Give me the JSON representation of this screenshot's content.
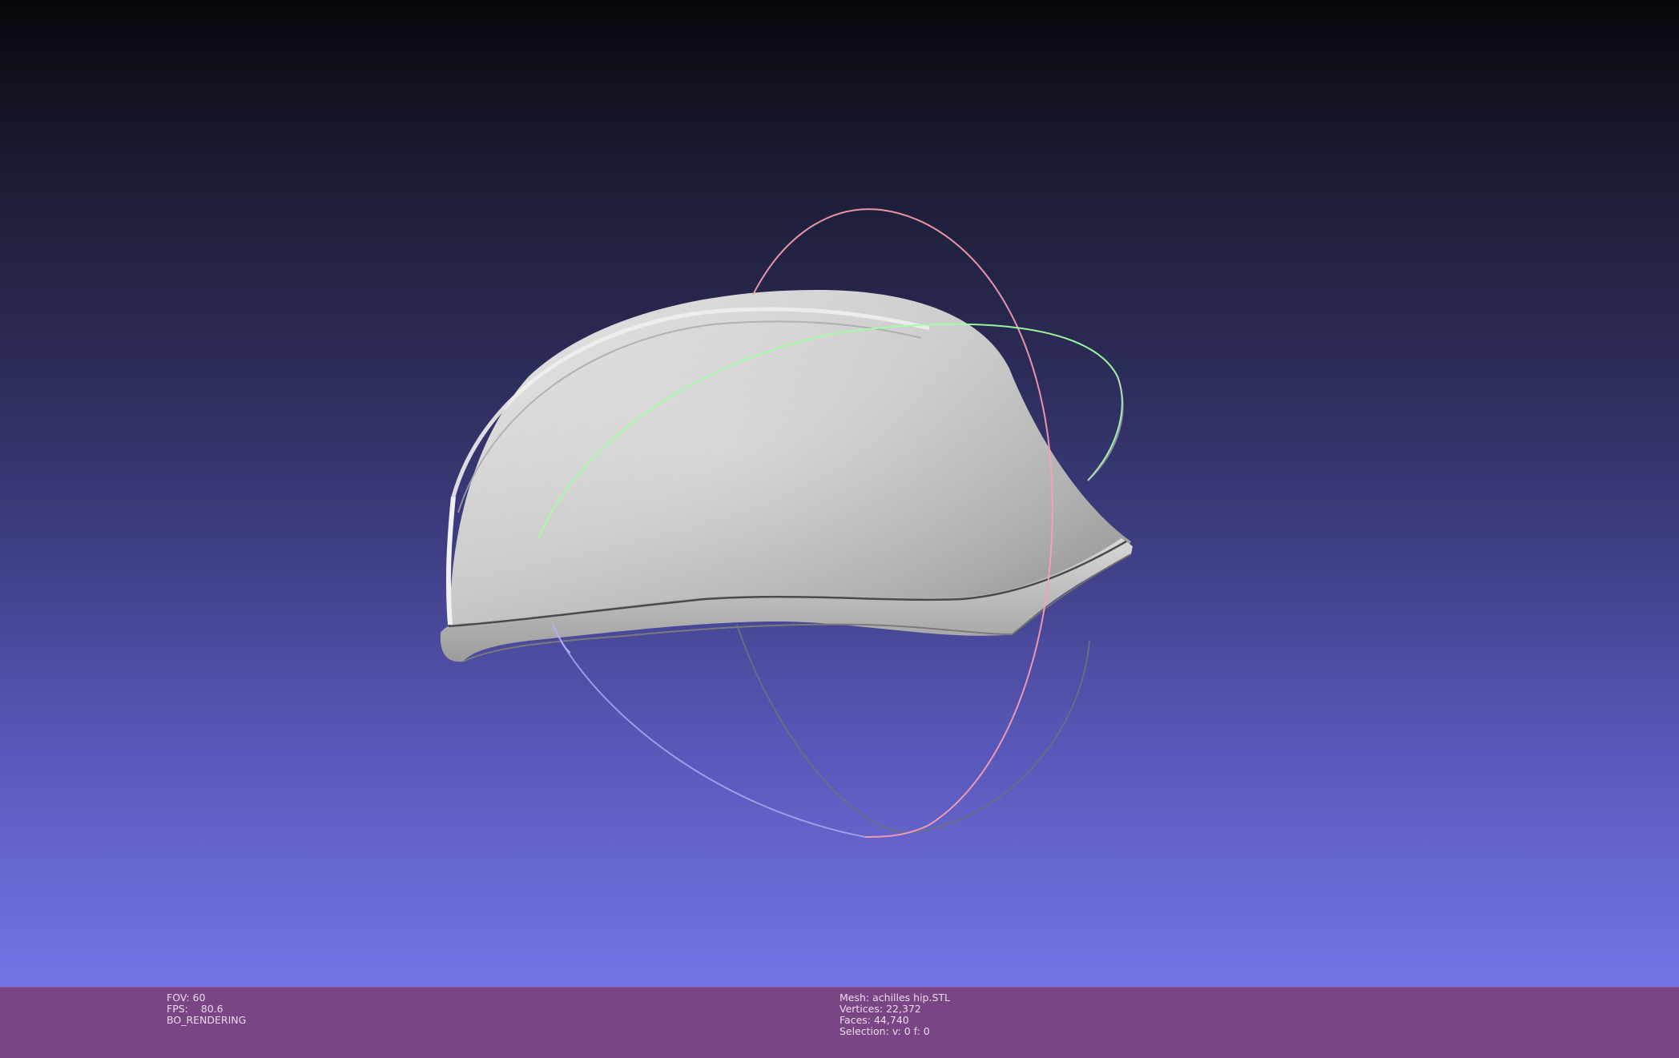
{
  "viewer": {
    "fov_label": "FOV:",
    "fov_value": "60",
    "fps_label": "FPS:",
    "fps_value": "80.6",
    "render_mode": "BO_RENDERING",
    "mesh_label": "Mesh:",
    "mesh_name": "achilles hip.STL",
    "vertices_label": "Vertices:",
    "vertices_value": "22,372",
    "faces_label": "Faces:",
    "faces_value": "44,740",
    "selection_label": "Selection:",
    "selection_value": "v: 0 f: 0"
  },
  "colors": {
    "background_top": "#07070b",
    "background_bottom": "#7474e6",
    "info_bar": "#7a4584",
    "mesh": "#c8c8c8",
    "trackball_x": "#ff9fb0",
    "trackball_y": "#a0ffa0",
    "trackball_z": "#b0b0ff"
  }
}
